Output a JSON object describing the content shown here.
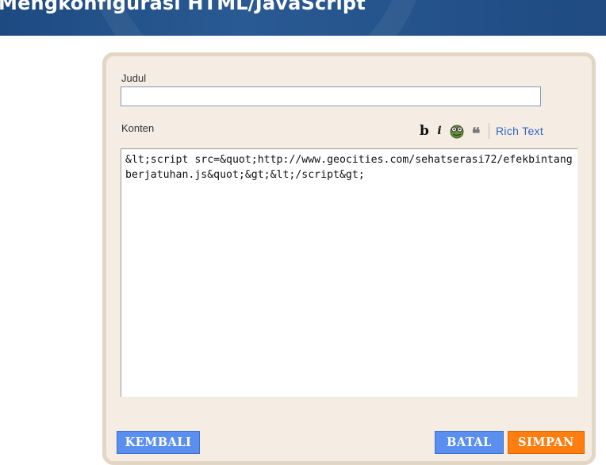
{
  "header": {
    "title": "Mengkonfigurasi HTML/JavaScript"
  },
  "form": {
    "title_label": "Judul",
    "title_value": "",
    "content_label": "Konten",
    "content_value": "&lt;script src=&quot;http://www.geocities.com/sehatserasi72/efekbintangberjatuhan.js&quot;&gt;&lt;/script&gt;"
  },
  "toolbar": {
    "bold": "b",
    "italic": "i",
    "quote": "❝",
    "rich_text": "Rich Text"
  },
  "buttons": {
    "back": "KEMBALI",
    "cancel": "BATAL",
    "save": "SIMPAN"
  },
  "colors": {
    "header_bg": "#1e4a82",
    "panel_bg": "#f5ede4",
    "panel_border": "#e3d6c4",
    "link": "#3366cc",
    "button_blue": "#5a8ff0",
    "button_orange": "#ff7e0f"
  },
  "icons": {
    "bold": "bold-icon",
    "italic": "italic-icon",
    "spellcheck": "spellcheck-icon",
    "quote": "blockquote-icon"
  }
}
